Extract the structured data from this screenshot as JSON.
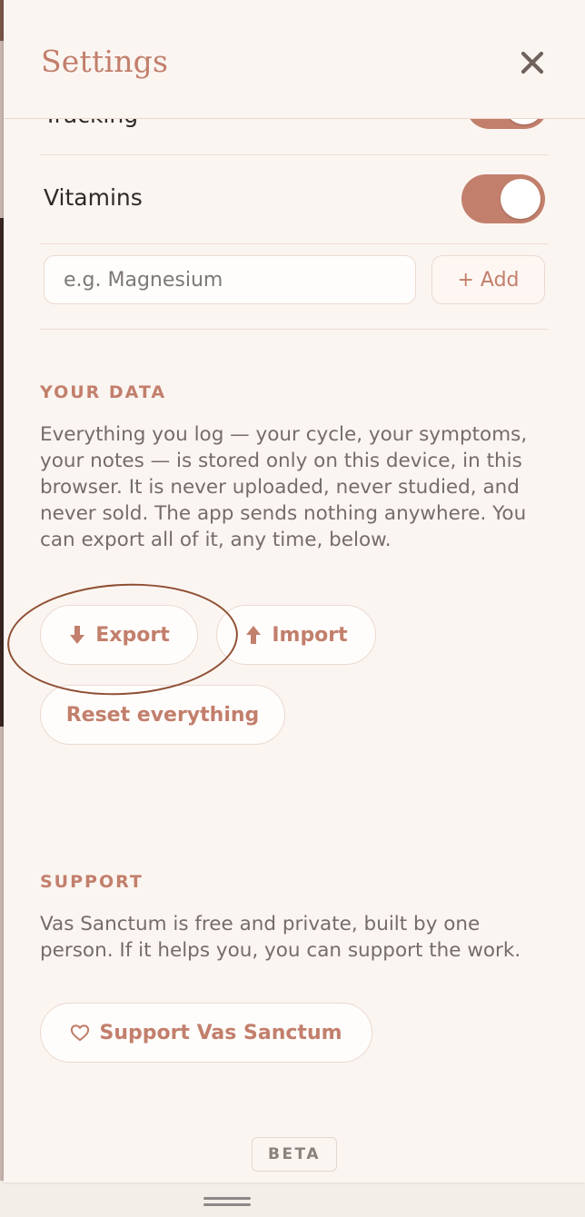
{
  "header": {
    "title": "Settings"
  },
  "toggles": {
    "partial_label": "Tracking",
    "vitamins_label": "Vitamins"
  },
  "add_item": {
    "placeholder": "e.g. Magnesium",
    "add_label": "+ Add"
  },
  "your_data": {
    "heading": "YOUR DATA",
    "body": "Everything you log — your cycle, your symptoms, your notes — is stored only on this device, in this browser. It is never uploaded, never studied, and never sold. The app sends nothing anywhere. You can export all of it, any time, below.",
    "export_label": "Export",
    "import_label": "Import",
    "reset_label": "Reset everything"
  },
  "support": {
    "heading": "SUPPORT",
    "body": "Vas Sanctum is free and private, built by one person. If it helps you, you can support the work.",
    "button_label": "Support Vas Sanctum"
  },
  "footer": {
    "badge": "BETA"
  },
  "icons": {
    "close": "close-icon",
    "export": "arrow-down-icon",
    "import": "arrow-up-icon",
    "support": "heart-icon"
  },
  "colors": {
    "accent": "#c27f6c",
    "background": "#fbf5f1",
    "annotation": "#8f4f33"
  }
}
